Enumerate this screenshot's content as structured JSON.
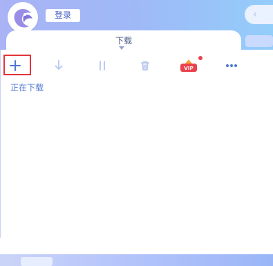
{
  "header": {
    "login_label": "登录",
    "nav_back_icon": "chevron-left-icon"
  },
  "tab": {
    "title": "下载"
  },
  "toolbar": {
    "items": [
      {
        "name": "add-icon"
      },
      {
        "name": "download-icon"
      },
      {
        "name": "pause-icon"
      },
      {
        "name": "trash-icon"
      },
      {
        "name": "vip-icon",
        "badge": "VIP"
      },
      {
        "name": "more-icon"
      }
    ],
    "highlight_color": "#e3333b"
  },
  "sections": {
    "downloading_label": "正在下载"
  },
  "colors": {
    "accent": "#4f78d1",
    "top_gradient_start": "#a9b3f5",
    "top_gradient_end": "#93cdfa",
    "icon_muted": "#bccbf0",
    "vip_red": "#e9424d"
  }
}
